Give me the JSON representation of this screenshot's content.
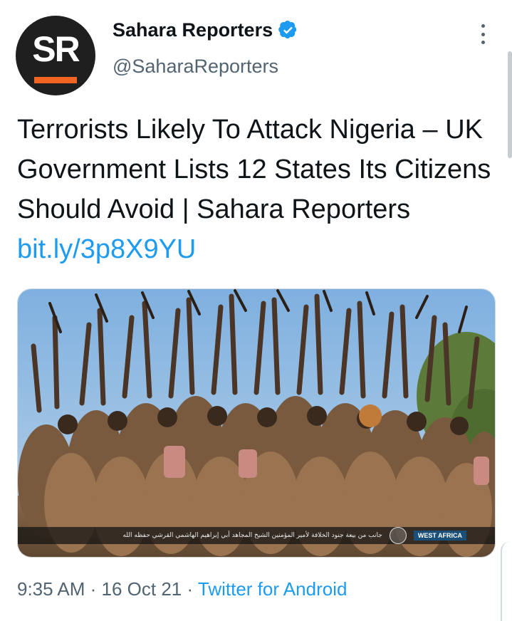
{
  "account": {
    "avatar_text": "SR",
    "display_name": "Sahara Reporters",
    "handle": "@SaharaReporters",
    "verified_icon": "verified-badge-icon"
  },
  "tweet": {
    "text": "Terrorists Likely To Attack Nigeria – UK Government Lists 12 States Its Citizens Should Avoid | Sahara Reporters ",
    "link": "bit.ly/3p8X9YU"
  },
  "media": {
    "caption_arabic": "جانب من بيعة جنود الخلافة لأمير المؤمنين الشيخ المجاهد أبي إبراهيم الهاشمي القرشي حفظه الله",
    "caption_tag": "WEST AFRICA"
  },
  "meta": {
    "time": "9:35 AM",
    "separator1": " · ",
    "date": "16 Oct 21",
    "separator2": " · ",
    "source": "Twitter for Android"
  },
  "colors": {
    "link": "#1d9bf0",
    "secondary_text": "#536471",
    "primary_text": "#0f1419",
    "avatar_bg": "#1f1f1f",
    "avatar_accent": "#f26522"
  }
}
